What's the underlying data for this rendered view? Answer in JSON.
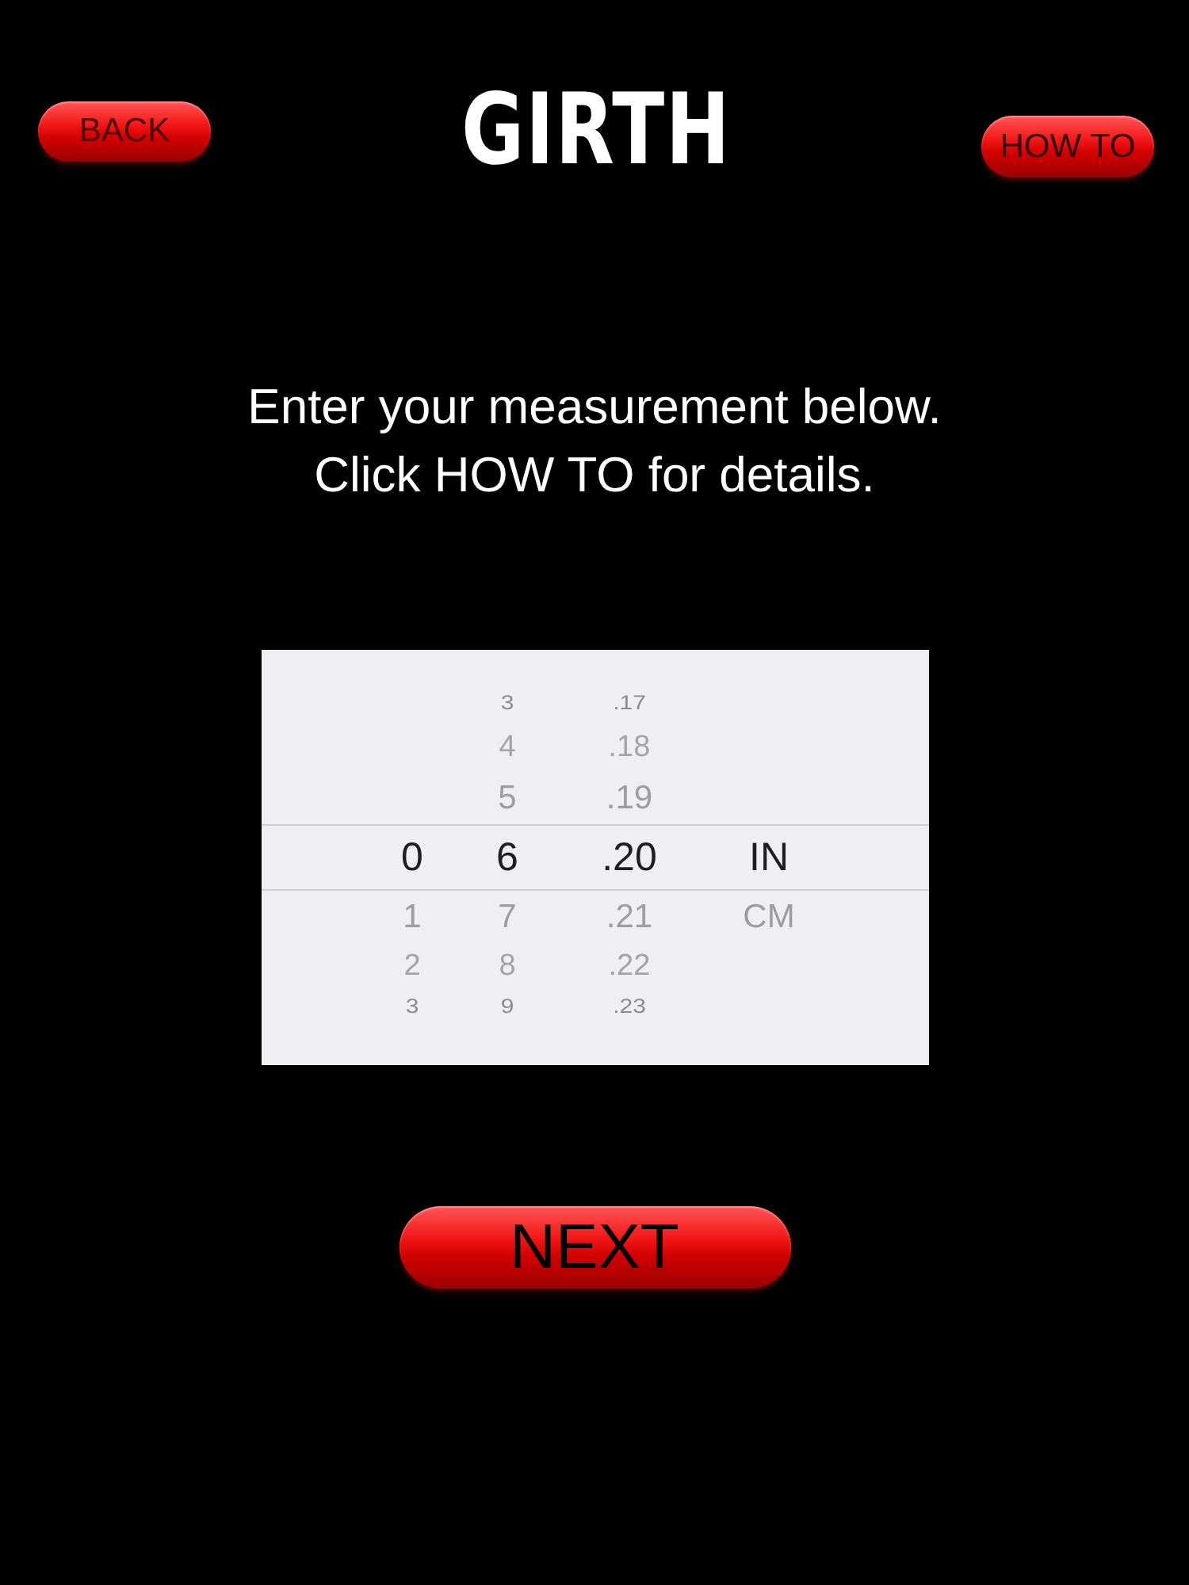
{
  "header": {
    "back_button": "BACK",
    "title": "GIRTH",
    "help_button": "HOW TO"
  },
  "instructions": [
    "Enter your measurement below.",
    "Click HOW TO for details."
  ],
  "picker": {
    "columns": [
      {
        "items": [
          {
            "label": "0",
            "selected": true
          },
          {
            "label": "1",
            "selected": false
          },
          {
            "label": "2",
            "selected": false
          },
          {
            "label": "3",
            "selected": false
          }
        ]
      },
      {
        "items": [
          {
            "label": "3",
            "selected": false
          },
          {
            "label": "4",
            "selected": false
          },
          {
            "label": "5",
            "selected": false
          },
          {
            "label": "6",
            "selected": true
          },
          {
            "label": "7",
            "selected": false
          },
          {
            "label": "8",
            "selected": false
          },
          {
            "label": "9",
            "selected": false
          }
        ]
      },
      {
        "items": [
          {
            "label": ".17",
            "selected": false
          },
          {
            "label": ".18",
            "selected": false
          },
          {
            "label": ".19",
            "selected": false
          },
          {
            "label": ".20",
            "selected": true
          },
          {
            "label": ".21",
            "selected": false
          },
          {
            "label": ".22",
            "selected": false
          },
          {
            "label": ".23",
            "selected": false
          }
        ]
      },
      {
        "items": [
          {
            "label": "IN",
            "selected": true
          },
          {
            "label": "CM",
            "selected": false
          }
        ]
      }
    ]
  },
  "next_button": "NEXT"
}
